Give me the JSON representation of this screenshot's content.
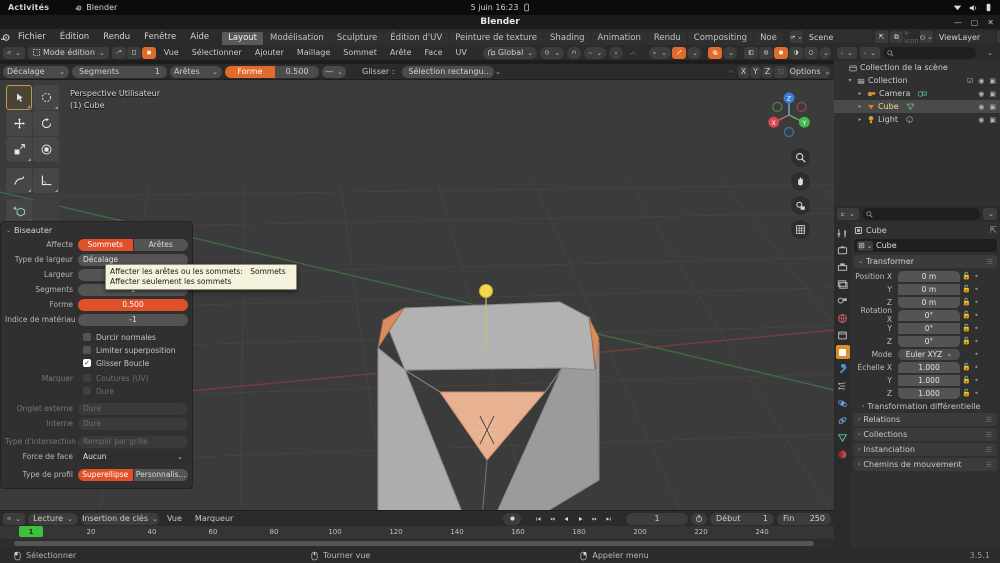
{
  "system_bar": {
    "activities": "Activités",
    "app_name": "Blender",
    "clock": "5 juin 16:23",
    "app_icon": "blender-icon",
    "battery_icon": "battery-icon",
    "network_icon": "network-icon",
    "volume_icon": "volume-icon",
    "power_icon": "power-icon"
  },
  "window": {
    "title": "Blender",
    "minimize": "—",
    "maximize": "▢",
    "close": "✕"
  },
  "topbar": {
    "logo": "blender-logo-icon",
    "menus": [
      "Fichier",
      "Édition",
      "Rendu",
      "Fenêtre",
      "Aide"
    ],
    "workspace_tabs": [
      {
        "label": "Layout",
        "active": true
      },
      {
        "label": "Modélisation",
        "active": false
      },
      {
        "label": "Sculpture",
        "active": false
      },
      {
        "label": "Édition d'UV",
        "active": false
      },
      {
        "label": "Peinture de texture",
        "active": false
      },
      {
        "label": "Shading",
        "active": false
      },
      {
        "label": "Animation",
        "active": false
      },
      {
        "label": "Rendu",
        "active": false
      },
      {
        "label": "Compositing",
        "active": false
      },
      {
        "label": "Noe",
        "active": false
      }
    ],
    "scene_name": "Scene",
    "viewlayer_name": "ViewLayer",
    "scene_icon": "scene-icon",
    "viewlayer_icon": "viewlayer-icon",
    "pin_icon": "pin-icon",
    "copy_icon": "copy-icon",
    "close_icon": "x-icon"
  },
  "viewport_header": {
    "editor_type_icon": "editor-type-icon",
    "mode": "Mode édition",
    "select_modes": [
      "vertex-select-icon",
      "edge-select-icon",
      "face-select-icon"
    ],
    "active_select_mode": 2,
    "menus": [
      "Vue",
      "Sélectionner",
      "Ajouter",
      "Maillage",
      "Sommet",
      "Arête",
      "Face",
      "UV"
    ],
    "transform_orientation": "Global",
    "pivot_icon": "pivot-icon",
    "snap_icon": "magnet-icon",
    "snap_target_icon": "snap-increment-icon",
    "proportional_icon": "proportional-edit-icon",
    "falloff_icon": "falloff-curve-icon",
    "visibility_icon": "mesh-visibility-icon",
    "xray_icon": "xray-icon",
    "overlays_icon": "overlays-icon",
    "shading_modes": [
      "wireframe-icon",
      "solid-icon",
      "material-preview-icon",
      "rendered-icon"
    ],
    "active_shading": 1
  },
  "tool_settings_row": {
    "width_type": "Décalage",
    "segments_label": "Segments",
    "segments_value": "1",
    "affect": "Arêtes",
    "shape_label": "Forme",
    "shape_value": "0.500",
    "profile_preset": "—",
    "drag_label": "Glisser :",
    "drag_value": "Sélection rectangu...",
    "axis_buttons": [
      "X",
      "Y",
      "Z"
    ],
    "mirror_icon": "mirror-icon",
    "snap_icon": "snap-icon",
    "options_label": "Options"
  },
  "viewport": {
    "view_label_line1": "Perspective Utilisateur",
    "view_label_line2": "(1) Cube",
    "gizmo_axes": [
      "X",
      "Y",
      "Z"
    ],
    "nav_buttons": [
      "zoom-icon",
      "pan-hand-icon",
      "camera-view-icon",
      "ortho-persp-icon"
    ],
    "toolbar": [
      {
        "name": "tweak-tool",
        "state": "active"
      },
      {
        "name": "select-box-tool",
        "state": "normal"
      },
      {
        "name": "move-tool",
        "state": "normal"
      },
      {
        "name": "rotate-tool",
        "state": "normal"
      },
      {
        "name": "scale-tool",
        "state": "normal"
      },
      {
        "name": "transform-tool",
        "state": "normal"
      },
      {
        "name": "annotate-tool",
        "state": "normal"
      },
      {
        "name": "measure-tool",
        "state": "normal"
      },
      {
        "name": "add-cube-tool",
        "state": "normal"
      },
      {
        "name": "extrude-region-tool",
        "state": "normal"
      },
      {
        "name": "inset-faces-tool",
        "state": "normal"
      },
      {
        "name": "bevel-tool",
        "state": "on"
      },
      {
        "name": "loop-cut-tool",
        "state": "normal"
      },
      {
        "name": "knife-tool",
        "state": "normal"
      },
      {
        "name": "poly-build-tool",
        "state": "normal"
      },
      {
        "name": "spin-tool",
        "state": "normal"
      },
      {
        "name": "smooth-tool",
        "state": "normal"
      },
      {
        "name": "edge-slide-tool",
        "state": "normal"
      },
      {
        "name": "shrink-fatten-tool",
        "state": "normal"
      },
      {
        "name": "shear-tool",
        "state": "normal"
      },
      {
        "name": "rip-region-tool",
        "state": "normal"
      }
    ]
  },
  "bevel_panel": {
    "title": "Biseauter",
    "affect_label": "Affecte",
    "affect_options": [
      "Sommets",
      "Arêtes"
    ],
    "affect_active": "Sommets",
    "width_type_label": "Type de largeur",
    "width_type_value": "Décalage",
    "width_label": "Largeur",
    "width_value": "",
    "segments_label": "Segments",
    "segments_value": "1",
    "shape_label": "Forme",
    "shape_value": "0.500",
    "material_index_label": "Indice de matériau",
    "material_index_value": "-1",
    "checkboxes": [
      {
        "label": "Durcir normales",
        "checked": false,
        "dim": false
      },
      {
        "label": "Limiter superposition",
        "checked": false,
        "dim": false
      },
      {
        "label": "Glisser Boucle",
        "checked": true,
        "dim": false
      }
    ],
    "mark_label": "Marquer",
    "mark_checkboxes": [
      {
        "label": "Coutures (UV)",
        "checked": false,
        "dim": true
      },
      {
        "label": "Dure",
        "checked": false,
        "dim": true
      }
    ],
    "outer_miter_label": "Onglet externe",
    "outer_miter_value": "Dure",
    "inner_miter_label": "Interne",
    "inner_miter_value": "Dure",
    "intersection_label": "Type d'intersection",
    "intersection_value": "Remplir par grille",
    "face_strength_label": "Force de face",
    "face_strength_value": "Aucun",
    "profile_type_label": "Type de profil",
    "profile_options": [
      "Superellipse",
      "Personnalis..."
    ],
    "profile_active": "Superellipse"
  },
  "tooltip": {
    "line1": "Affecter les arêtes ou les sommets:",
    "line1_value": "Sommets",
    "line2": "Affecter seulement les sommets"
  },
  "outliner": {
    "display_mode_icon": "outliner-display-icon",
    "filter_icon": "filter-icon",
    "search_placeholder": "",
    "search_icon": "search-icon",
    "rows": [
      {
        "label": "Collection de la scène",
        "indent": 0,
        "icon": "scene-collection-icon",
        "selected": false,
        "has_arrow": false,
        "show_toggles": false
      },
      {
        "label": "Collection",
        "indent": 1,
        "icon": "collection-icon",
        "selected": false,
        "has_arrow": true,
        "show_toggles": true,
        "checkbox": true
      },
      {
        "label": "Camera",
        "indent": 2,
        "icon": "camera-icon",
        "selected": false,
        "has_arrow": true,
        "show_toggles": true,
        "data_icon": "camera-data-icon"
      },
      {
        "label": "Cube",
        "indent": 2,
        "icon": "mesh-icon",
        "selected": true,
        "has_arrow": true,
        "show_toggles": true,
        "data_icon": "mesh-data-icon"
      },
      {
        "label": "Light",
        "indent": 2,
        "icon": "light-icon",
        "selected": false,
        "has_arrow": true,
        "show_toggles": true,
        "data_icon": "light-data-icon"
      }
    ],
    "eye_icon": "eye-icon",
    "camera_icon": "render-camera-icon"
  },
  "properties": {
    "editor_icon": "properties-editor-icon",
    "search_icon": "search-icon",
    "search_placeholder": "",
    "tabs": [
      {
        "name": "tool-tab",
        "icon": "tool-icon",
        "active": false
      },
      {
        "name": "render-tab",
        "icon": "render-icon",
        "active": false
      },
      {
        "name": "output-tab",
        "icon": "output-printer-icon",
        "active": false
      },
      {
        "name": "viewlayer-tab",
        "icon": "viewlayer-images-icon",
        "active": false
      },
      {
        "name": "scene-tab",
        "icon": "scene-cone-icon",
        "active": false
      },
      {
        "name": "world-tab",
        "icon": "world-globe-icon",
        "active": false
      },
      {
        "name": "collection-tab",
        "icon": "collection-box-icon",
        "active": false
      },
      {
        "name": "object-tab",
        "icon": "object-square-icon",
        "active": true
      },
      {
        "name": "modifier-tab",
        "icon": "wrench-icon",
        "active": false
      },
      {
        "name": "particles-tab",
        "icon": "particles-icon",
        "active": false
      },
      {
        "name": "physics-tab",
        "icon": "physics-orbit-icon",
        "active": false
      },
      {
        "name": "constraints-tab",
        "icon": "constraints-icon",
        "active": false
      },
      {
        "name": "data-tab",
        "icon": "mesh-data-triangle-icon",
        "active": false
      },
      {
        "name": "material-tab",
        "icon": "material-sphere-icon",
        "active": false
      }
    ],
    "breadcrumb_object": "Cube",
    "pin_icon": "pin-icon",
    "object_name": "Cube",
    "object_icon": "object-square-icon",
    "transform_panel": "Transformer",
    "location": {
      "label": "Position X",
      "x": "0 m",
      "y": "0 m",
      "z": "0 m",
      "y_label": "Y",
      "z_label": "Z"
    },
    "rotation": {
      "label": "Rotation X",
      "x": "0°",
      "y": "0°",
      "z": "0°",
      "y_label": "Y",
      "z_label": "Z"
    },
    "mode_label": "Mode",
    "mode_value": "Euler XYZ",
    "scale": {
      "label": "Échelle X",
      "x": "1.000",
      "y": "1.000",
      "z": "1.000",
      "y_label": "Y",
      "z_label": "Z"
    },
    "delta_transform": "Transformation différentielle",
    "collapsed_panels": [
      "Relations",
      "Collections",
      "Instanciation",
      "Chemins de mouvement"
    ]
  },
  "timeline": {
    "editor_icon": "timeline-editor-icon",
    "playback_label": "Lecture",
    "keying_label": "Insertion de clés",
    "menus": [
      "Vue",
      "Marqueur"
    ],
    "record_icon": "record-icon",
    "transport": [
      "jump-start-icon",
      "prev-keyframe-icon",
      "play-reverse-icon",
      "play-icon",
      "next-keyframe-icon",
      "jump-end-icon"
    ],
    "current_frame": "1",
    "auto_key_icon": "stopwatch-icon",
    "start_label": "Début",
    "start_value": "1",
    "end_label": "Fin",
    "end_value": "250",
    "ticks": [
      "20",
      "40",
      "60",
      "80",
      "100",
      "120",
      "140",
      "160",
      "180",
      "200",
      "220",
      "240"
    ],
    "playhead_frame": "1"
  },
  "status_bar": {
    "items": [
      {
        "icon": "mouse-left-icon",
        "label": "Sélectionner"
      },
      {
        "icon": "mouse-middle-icon",
        "label": "Tourner vue"
      },
      {
        "icon": "mouse-right-icon",
        "label": "Appeler menu"
      }
    ],
    "version": "3.5.1"
  },
  "colors": {
    "accent_orange": "#e0512a",
    "active_tab": "#5a5a5a",
    "viewport_bg": "#3b3b3b",
    "panel_bg": "#303030",
    "header_bg": "#2b2b2b",
    "selected_green": "#3ec23e",
    "tooltip_bg": "#f4f1dd"
  }
}
